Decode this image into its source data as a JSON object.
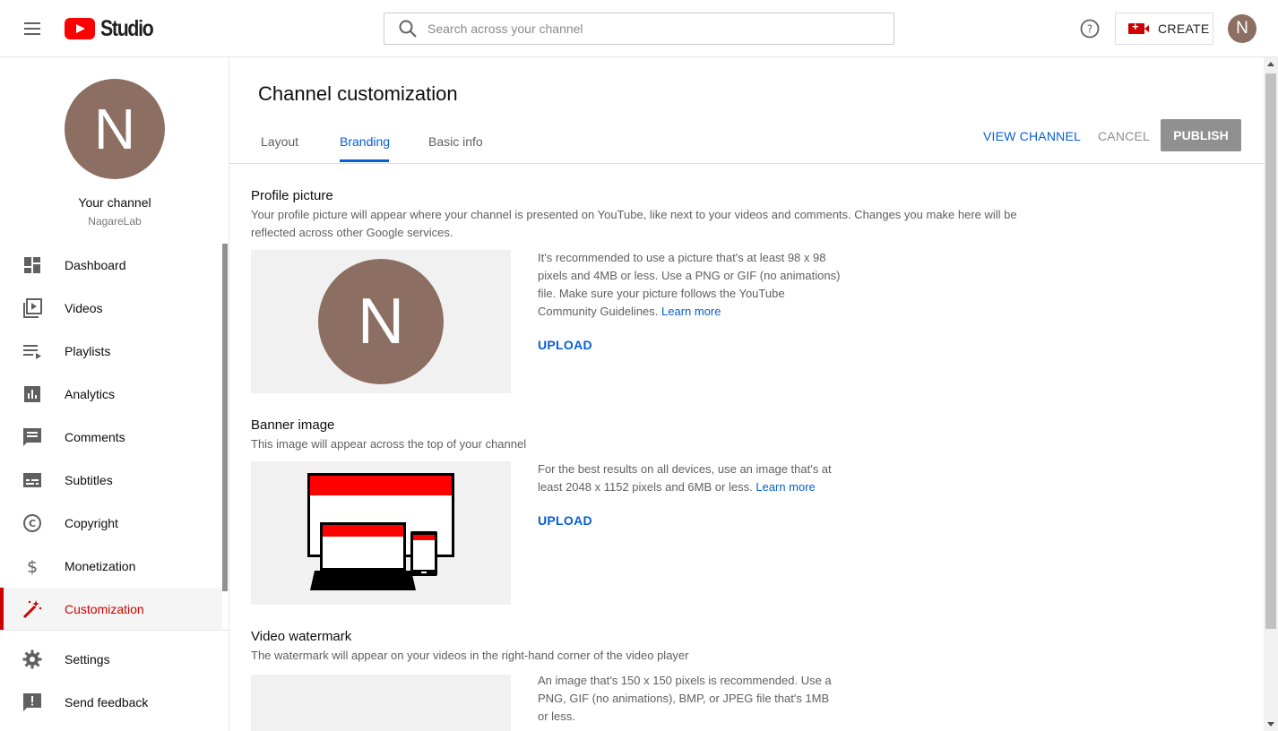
{
  "header": {
    "logo_text": "Studio",
    "search_placeholder": "Search across your channel",
    "create_label": "CREATE",
    "avatar_letter": "N"
  },
  "sidebar": {
    "avatar_letter": "N",
    "channel_title": "Your channel",
    "channel_handle": "NagareLab",
    "items": [
      {
        "label": "Dashboard",
        "icon": "dashboard-icon"
      },
      {
        "label": "Videos",
        "icon": "videos-icon"
      },
      {
        "label": "Playlists",
        "icon": "playlists-icon"
      },
      {
        "label": "Analytics",
        "icon": "analytics-icon"
      },
      {
        "label": "Comments",
        "icon": "comments-icon"
      },
      {
        "label": "Subtitles",
        "icon": "subtitles-icon"
      },
      {
        "label": "Copyright",
        "icon": "copyright-icon"
      },
      {
        "label": "Monetization",
        "icon": "dollar-icon"
      },
      {
        "label": "Customization",
        "icon": "magic-wand-icon"
      }
    ],
    "bottom_items": [
      {
        "label": "Settings",
        "icon": "gear-icon"
      },
      {
        "label": "Send feedback",
        "icon": "feedback-icon"
      }
    ],
    "active_item": "Customization"
  },
  "main": {
    "title": "Channel customization",
    "tabs": [
      {
        "label": "Layout"
      },
      {
        "label": "Branding"
      },
      {
        "label": "Basic info"
      }
    ],
    "active_tab": "Branding",
    "actions": {
      "view_channel": "VIEW CHANNEL",
      "cancel": "CANCEL",
      "publish": "PUBLISH"
    },
    "profile": {
      "title": "Profile picture",
      "desc_line1": "Your profile picture will appear where your channel is presented on YouTube, like next to your videos and comments. Changes you make here will be",
      "desc_line2": "reflected across other Google services.",
      "avatar_letter": "N",
      "hint": "It's recommended to use a picture that's at least 98 x 98 pixels and 4MB or less. Use a PNG or GIF (no animations) file. Make sure your picture follows the YouTube Community Guidelines.",
      "learn_more": "Learn more",
      "upload": "UPLOAD"
    },
    "banner": {
      "title": "Banner image",
      "desc": "This image will appear across the top of your channel",
      "hint": "For the best results on all devices, use an image that's at least 2048 x 1152 pixels and 6MB or less.",
      "learn_more": "Learn more",
      "upload": "UPLOAD"
    },
    "watermark": {
      "title": "Video watermark",
      "desc": "The watermark will appear on your videos in the right-hand corner of the video player",
      "hint": "An image that's 150 x 150 pixels is recommended. Use a PNG, GIF (no animations), BMP, or JPEG file that's 1MB or less."
    }
  },
  "colors": {
    "accent_blue": "#065fd4",
    "brand_red": "#cc0000",
    "avatar_brown": "#8d6e63"
  }
}
